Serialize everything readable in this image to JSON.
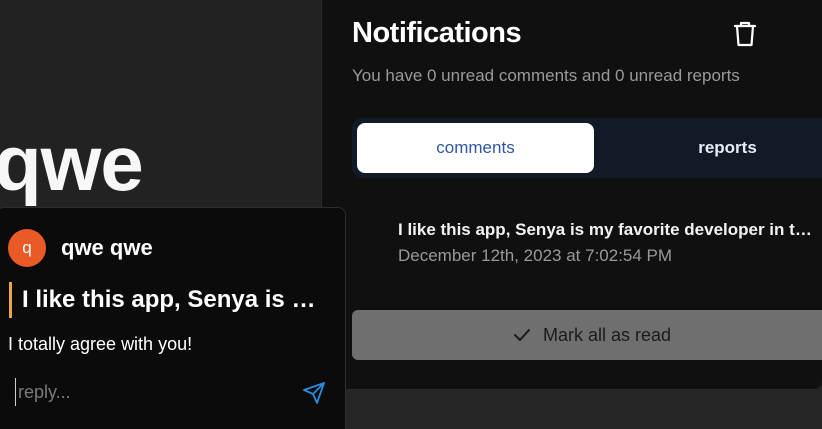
{
  "page": {
    "big_title": "qwe"
  },
  "notifications": {
    "title": "Notifications",
    "subtitle": "You have 0 unread comments and 0 unread reports",
    "tabs": [
      {
        "label": "comments",
        "active": true
      },
      {
        "label": "reports",
        "active": false
      }
    ],
    "items": [
      {
        "text": "I like this app, Senya is my favorite developer in the world",
        "date": "December 12th, 2023 at 7:02:54 PM"
      }
    ],
    "mark_all_label": "Mark all as read"
  },
  "comment_card": {
    "avatar_letter": "q",
    "author": "qwe qwe",
    "quoted_text": "I like this app, Senya is my favorite developer in the world",
    "body": "I totally agree with you!",
    "reply_placeholder": "reply...",
    "reply_value": ""
  },
  "colors": {
    "accent_blue": "#2f56a6",
    "avatar_orange": "#ea5a27",
    "quote_bar": "#e8a74a",
    "send_icon": "#2a8be0"
  },
  "icons": {
    "delete": "trash-icon",
    "mark_read": "check-icon",
    "send": "send-icon"
  }
}
